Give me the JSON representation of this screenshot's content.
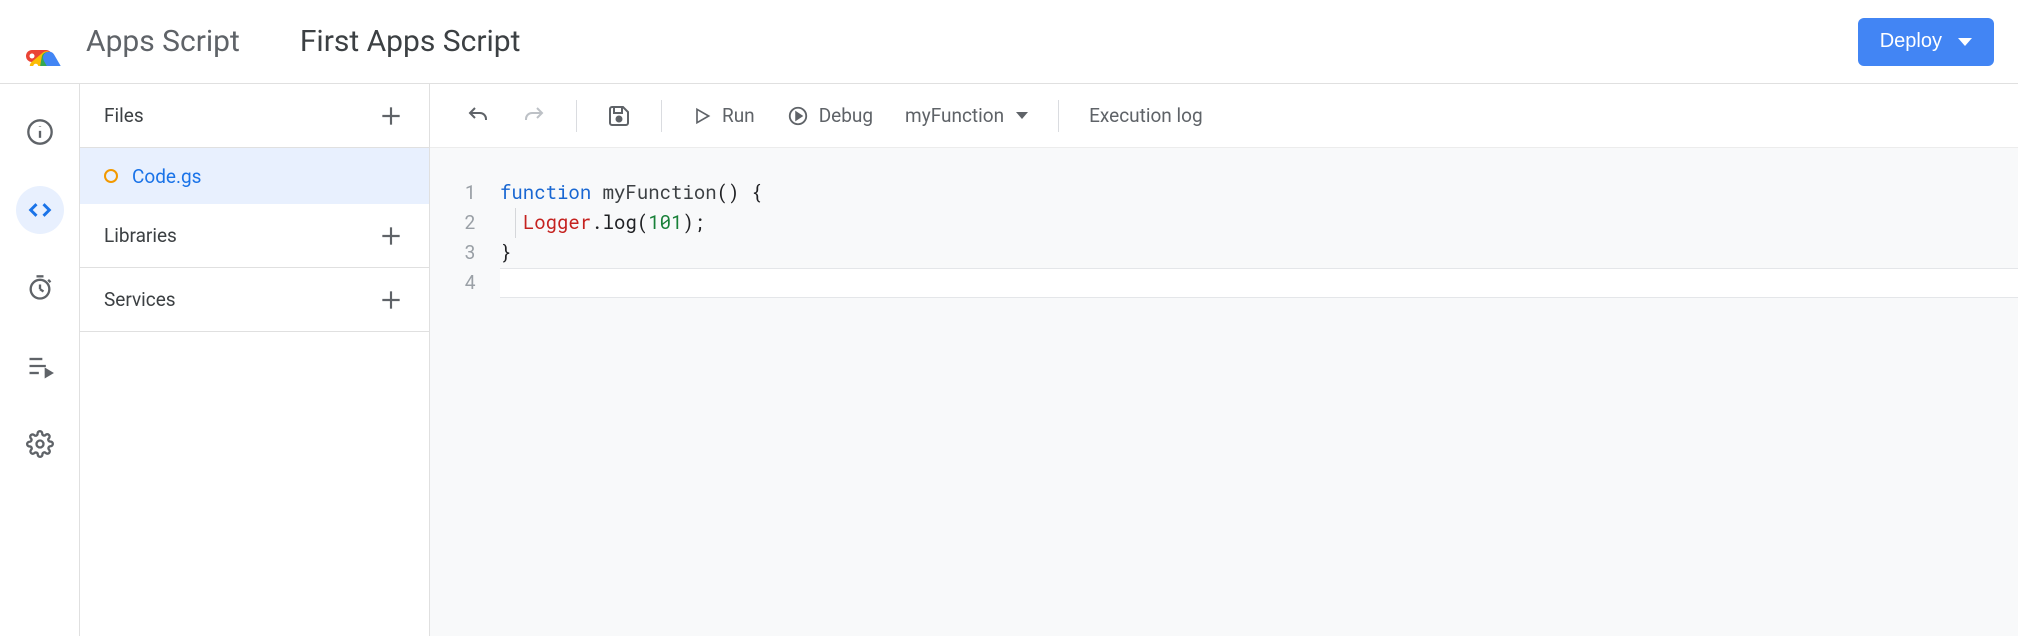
{
  "header": {
    "product_name": "Apps Script",
    "project_title": "First Apps Script",
    "deploy_label": "Deploy"
  },
  "rail": {
    "items": [
      {
        "name": "overview"
      },
      {
        "name": "editor"
      },
      {
        "name": "triggers"
      },
      {
        "name": "executions"
      },
      {
        "name": "settings"
      }
    ]
  },
  "sidebar": {
    "files_label": "Files",
    "libraries_label": "Libraries",
    "services_label": "Services",
    "files": [
      {
        "name": "Code.gs",
        "modified": true
      }
    ]
  },
  "toolbar": {
    "run_label": "Run",
    "debug_label": "Debug",
    "function_selected": "myFunction",
    "execution_log_label": "Execution log"
  },
  "code": {
    "line_numbers": [
      "1",
      "2",
      "3",
      "4"
    ],
    "tokens": [
      [
        {
          "t": "function ",
          "c": "kw"
        },
        {
          "t": "myFunction",
          "c": "fnname"
        },
        {
          "t": "() {",
          "c": ""
        }
      ],
      [
        {
          "t": "  ",
          "c": ""
        },
        {
          "t": "Logger",
          "c": "obj"
        },
        {
          "t": ".log(",
          "c": ""
        },
        {
          "t": "101",
          "c": "num"
        },
        {
          "t": ");",
          "c": ""
        }
      ],
      [
        {
          "t": "}",
          "c": ""
        }
      ],
      []
    ]
  }
}
